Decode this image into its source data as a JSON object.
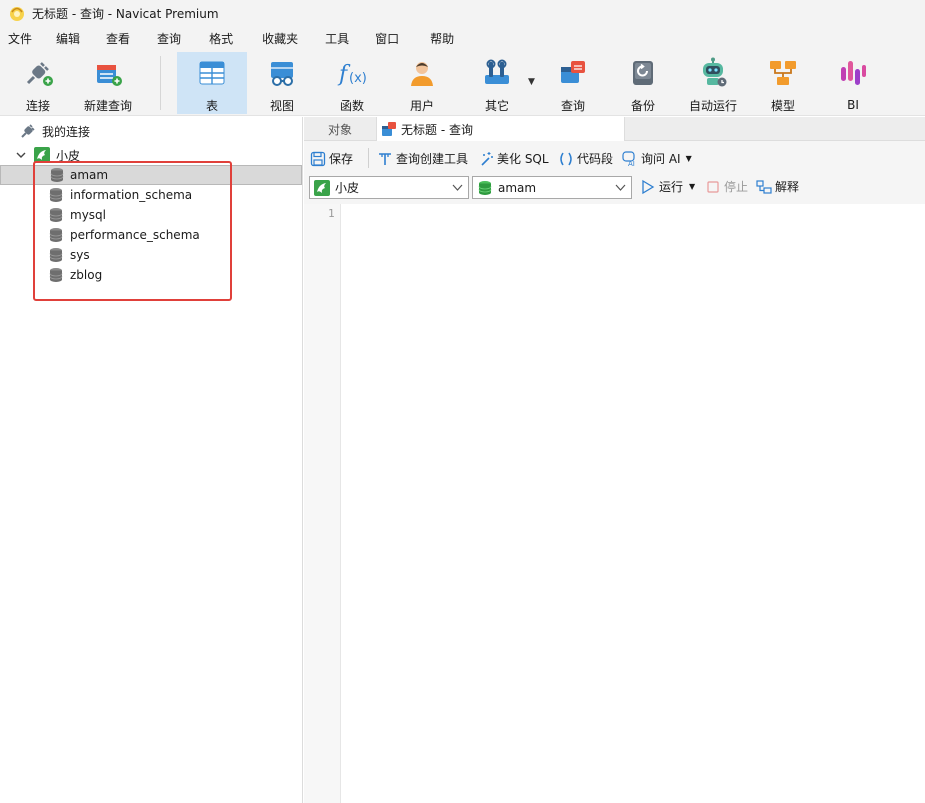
{
  "window": {
    "title": "无标题 - 查询 - Navicat Premium"
  },
  "menu": [
    "文件",
    "编辑",
    "查看",
    "查询",
    "格式",
    "收藏夹",
    "工具",
    "窗口",
    "帮助"
  ],
  "toolbar": {
    "connect": "连接",
    "new_query": "新建查询",
    "table": "表",
    "view": "视图",
    "function": "函数",
    "user": "用户",
    "other": "其它",
    "query": "查询",
    "backup": "备份",
    "automation": "自动运行",
    "model": "模型",
    "bi": "BI"
  },
  "tree": {
    "root": "我的连接",
    "connection": "小皮",
    "databases": [
      "amam",
      "information_schema",
      "mysql",
      "performance_schema",
      "sys",
      "zblog"
    ],
    "selected": "amam"
  },
  "tabs": {
    "objects": "对象",
    "active": "无标题 - 查询"
  },
  "query_toolbar": {
    "save": "保存",
    "query_builder": "查询创建工具",
    "beautify": "美化 SQL",
    "snippets": "代码段",
    "ask_ai": "询问 AI",
    "run": "运行",
    "stop": "停止",
    "explain": "解释"
  },
  "selectors": {
    "connection": "小皮",
    "database": "amam"
  },
  "editor": {
    "line_numbers": [
      "1"
    ]
  },
  "colors": {
    "active_tool": "#cfe4f6",
    "highlight_box": "#e0403a",
    "connection_icon": "#3aa349"
  }
}
